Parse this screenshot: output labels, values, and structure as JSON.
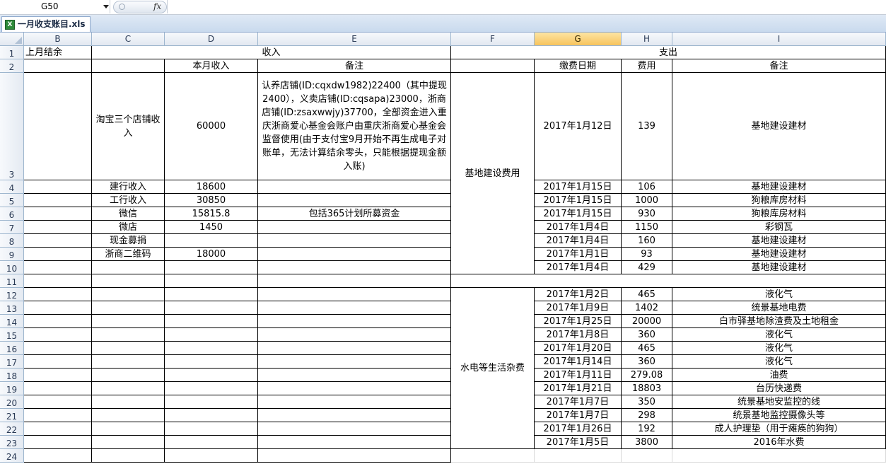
{
  "formula_bar": {
    "name_box": "G50",
    "fx": "fx",
    "formula": ""
  },
  "tab": {
    "filename": "一月收支账目.xls",
    "icon": "excel-file-icon"
  },
  "columns": [
    "B",
    "C",
    "D",
    "E",
    "F",
    "G",
    "H",
    "I"
  ],
  "selected_column": "G",
  "rows": [
    "1",
    "2",
    "3",
    "4",
    "5",
    "6",
    "7",
    "8",
    "9",
    "10",
    "11",
    "12",
    "13",
    "14",
    "15",
    "16",
    "17",
    "18",
    "19",
    "20",
    "21",
    "22",
    "23",
    "24"
  ],
  "header": {
    "b1": "上月结余",
    "income": "收入",
    "expense": "支出",
    "monthly_income": "本月收入",
    "remarks_income": "备注",
    "pay_date": "缴费日期",
    "fee": "费用",
    "remarks_expense": "备注"
  },
  "income": [
    {
      "source": "淘宝三个店铺收入",
      "amount": "60000",
      "note": "认养店铺(ID:cqxdw1982)22400（其中提现2400），义卖店铺(ID:cqsapa)23000，浙商店铺(ID:zsaxwwjy)37700，全部资金进入重庆浙商爱心基金会账户由重庆浙商爱心基金会监督使用(由于支付宝9月开始不再生成电子对账单，无法计算结余零头，只能根据提现金额入账)"
    },
    {
      "source": "建行收入",
      "amount": "18600",
      "note": ""
    },
    {
      "source": "工行收入",
      "amount": "30850",
      "note": ""
    },
    {
      "source": "微信",
      "amount": "15815.8",
      "note": "包括365计划所募资金"
    },
    {
      "source": "微店",
      "amount": "1450",
      "note": ""
    },
    {
      "source": "现金募捐",
      "amount": "",
      "note": ""
    },
    {
      "source": "浙商二维码",
      "amount": "18000",
      "note": ""
    }
  ],
  "expense_groups": [
    {
      "category": "基地建设费用",
      "items": [
        {
          "date": "2017年1月12日",
          "fee": "139",
          "note": "基地建设建材"
        },
        {
          "date": "2017年1月15日",
          "fee": "106",
          "note": "基地建设建材"
        },
        {
          "date": "2017年1月15日",
          "fee": "1000",
          "note": "狗粮库房材料"
        },
        {
          "date": "2017年1月15日",
          "fee": "930",
          "note": "狗粮库房材料"
        },
        {
          "date": "2017年1月4日",
          "fee": "1150",
          "note": "彩钢瓦"
        },
        {
          "date": "2017年1月4日",
          "fee": "160",
          "note": "基地建设建材"
        },
        {
          "date": "2017年1月1日",
          "fee": "93",
          "note": "基地建设建材"
        },
        {
          "date": "2017年1月4日",
          "fee": "429",
          "note": "基地建设建材"
        }
      ]
    },
    {
      "category": "水电等生活杂费",
      "items": [
        {
          "date": "2017年1月2日",
          "fee": "465",
          "note": "液化气"
        },
        {
          "date": "2017年1月9日",
          "fee": "1402",
          "note": "统景基地电费"
        },
        {
          "date": "2017年1月25日",
          "fee": "20000",
          "note": "白市驿基地除渣费及土地租金"
        },
        {
          "date": "2017年1月8日",
          "fee": "360",
          "note": "液化气"
        },
        {
          "date": "2017年1月20日",
          "fee": "465",
          "note": "液化气"
        },
        {
          "date": "2017年1月14日",
          "fee": "360",
          "note": "液化气"
        },
        {
          "date": "2017年1月11日",
          "fee": "279.08",
          "note": "油费"
        },
        {
          "date": "2017年1月21日",
          "fee": "18803",
          "note": "台历快递费"
        },
        {
          "date": "2017年1月7日",
          "fee": "350",
          "note": "统景基地安监控的线"
        },
        {
          "date": "2017年1月7日",
          "fee": "298",
          "note": "统景基地监控摄像头等"
        },
        {
          "date": "2017年1月26日",
          "fee": "192",
          "note": "成人护理垫（用于瘫痪的狗狗）"
        },
        {
          "date": "2017年1月5日",
          "fee": "3800",
          "note": "2016年水费"
        }
      ]
    }
  ]
}
